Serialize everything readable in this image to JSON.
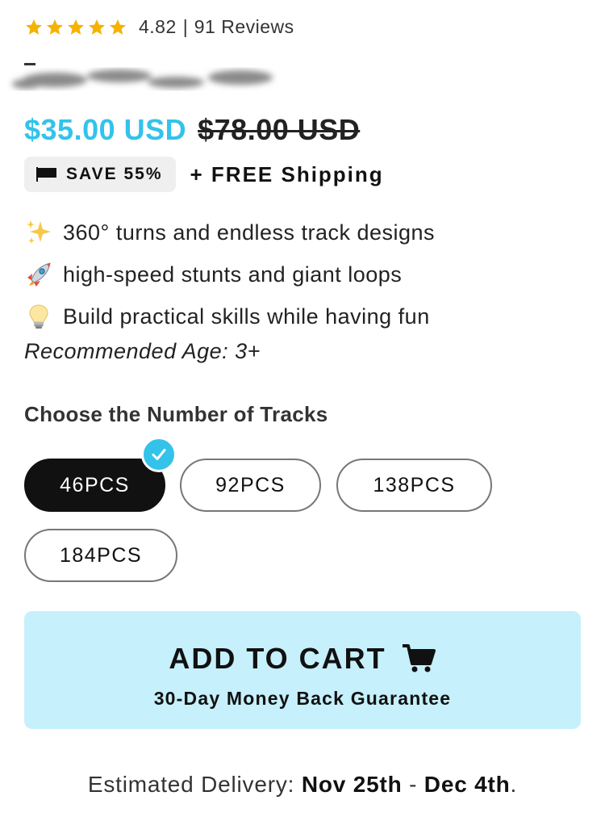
{
  "rating": {
    "score": "4.82",
    "separator": "|",
    "reviews": "91 Reviews",
    "stars": 5,
    "star_color": "#f5b301"
  },
  "price": {
    "current": "$35.00 USD",
    "original": "$78.00 USD",
    "current_color": "#33c3ea"
  },
  "badge": {
    "save": "SAVE 55%",
    "shipping": "+ FREE Shipping",
    "icon": "flag-icon"
  },
  "features": [
    {
      "icon": "sparkles-icon",
      "text": "360° turns and endless track designs"
    },
    {
      "icon": "rocket-icon",
      "text": "high-speed stunts and giant loops"
    },
    {
      "icon": "lightbulb-icon",
      "text": "Build practical skills while having fun"
    }
  ],
  "age": "Recommended Age: 3+",
  "tracks": {
    "heading": "Choose the Number of Tracks",
    "options": [
      "46PCS",
      "92PCS",
      "138PCS",
      "184PCS"
    ],
    "selected": "46PCS"
  },
  "cart": {
    "label": "ADD TO CART",
    "guarantee": "30-Day Money Back Guarantee",
    "bg_color": "#c6f0fb"
  },
  "delivery": {
    "prefix": "Estimated Delivery:",
    "start": "Nov 25th",
    "dash": "-",
    "end": "Dec 4th",
    "suffix": "."
  }
}
